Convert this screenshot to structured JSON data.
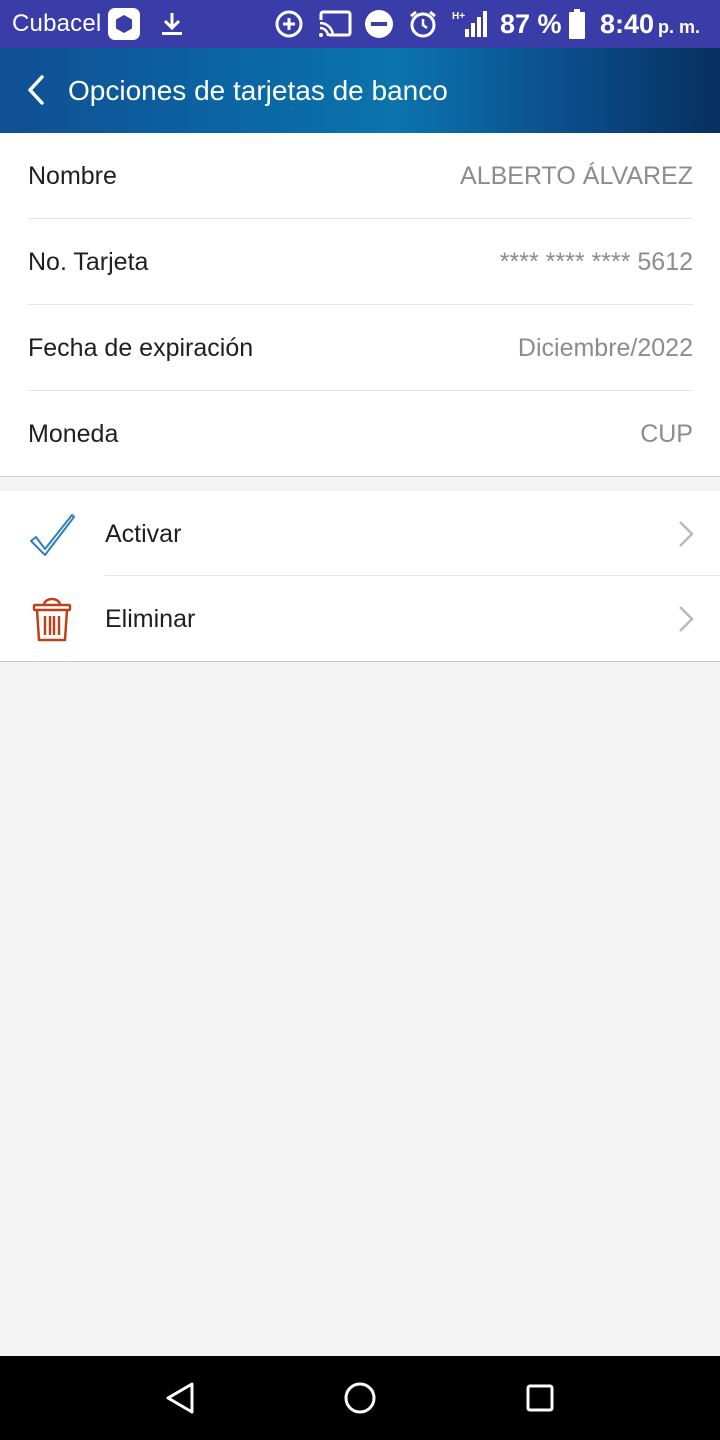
{
  "status_bar": {
    "carrier": "Cubacel",
    "icons": [
      "vpn-icon",
      "download-icon",
      "data-saver-icon",
      "cast-icon",
      "do-not-disturb-icon",
      "alarm-icon",
      "signal-icon",
      "battery-icon"
    ],
    "network_type": "H+",
    "battery": "87 %",
    "time": "8:40",
    "ampm": "p. m."
  },
  "header": {
    "title": "Opciones de tarjetas de banco"
  },
  "card_info": {
    "rows": [
      {
        "label": "Nombre",
        "value": "ALBERTO ÁLVAREZ"
      },
      {
        "label": "No. Tarjeta",
        "value": "**** **** **** 5612"
      },
      {
        "label": "Fecha de expiración",
        "value": "Diciembre/2022"
      },
      {
        "label": "Moneda",
        "value": "CUP"
      }
    ]
  },
  "actions": [
    {
      "label": "Activar",
      "icon": "checkmark-icon",
      "color": "#2f7fc0"
    },
    {
      "label": "Eliminar",
      "icon": "trash-icon",
      "color": "#c0401a"
    }
  ],
  "nav_bar": {
    "buttons": [
      "back-nav-icon",
      "home-nav-icon",
      "recents-nav-icon"
    ]
  }
}
